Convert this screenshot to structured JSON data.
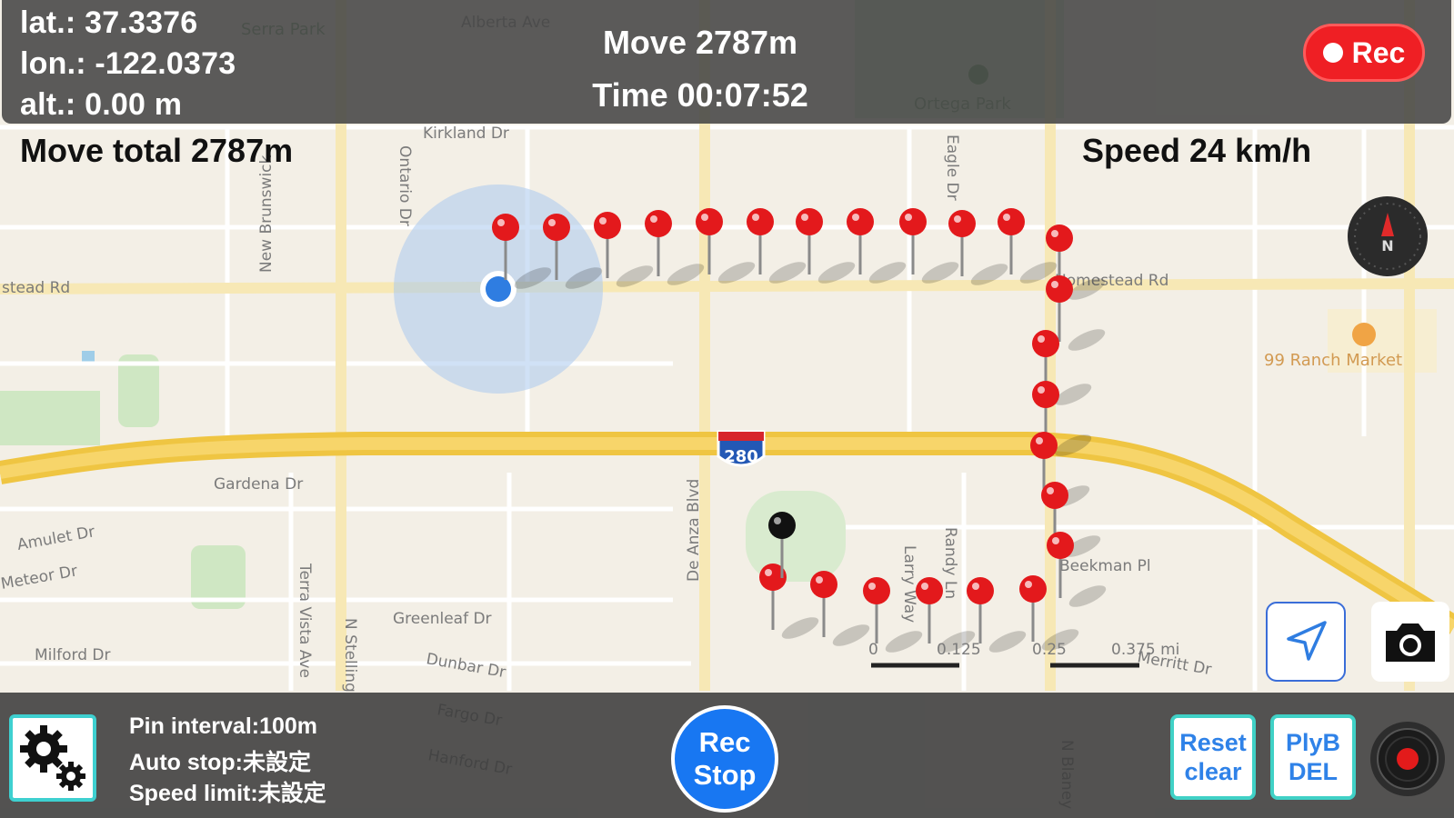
{
  "map": {
    "street_labels": [
      "Alberta Ave",
      "Serra Park",
      "Ortega Park",
      "Kirkland Dr",
      "Ontario Dr",
      "New Brunswick",
      "stead Rd",
      "Homestead Rd",
      "99 Ranch Market",
      "Gardena Dr",
      "Amulet Dr",
      "Meteor Dr",
      "Milford Dr",
      "Greenleaf Dr",
      "Dunbar Dr",
      "Fargo Dr",
      "Hanford Dr",
      "Larry Way",
      "Randy Ln",
      "Beekman Pl",
      "Merritt Dr",
      "N Stelling",
      "De Anza Blvd",
      "Terra Vista Ave",
      "N Blaney",
      "Eagle Dr"
    ],
    "highway_shield": "280",
    "scale_labels": [
      "0",
      "0.125",
      "0.25",
      "0.375 mi"
    ]
  },
  "header": {
    "lat": "lat.: 37.3376",
    "lon": "lon.: -122.0373",
    "alt": "alt.: 0.00 m",
    "move": "Move 2787m",
    "time": "Time 00:07:52",
    "rec_label": "Rec"
  },
  "overlay": {
    "move_total": "Move total 2787m",
    "speed": "Speed 24 km/h",
    "compass_letter": "N"
  },
  "footer": {
    "pin_interval": "Pin interval:100m",
    "auto_stop": "Auto stop:未設定",
    "speed_limit": "Speed limit:未設定",
    "rec_stop_line1": "Rec",
    "rec_stop_line2": "Stop",
    "reset_line1": "Reset",
    "reset_line2": "clear",
    "plyb_line1": "PlyB",
    "plyb_line2": "DEL"
  },
  "colors": {
    "pin_red": "#e3191c",
    "rec_red": "#ef1f24",
    "accent_blue": "#1877f2",
    "highway_yellow": "#f2c94c",
    "button_border": "#40d1c6"
  },
  "icons": [
    "gear-icon",
    "location-arrow-icon",
    "camera-icon",
    "compass-icon",
    "record-disc-icon"
  ]
}
